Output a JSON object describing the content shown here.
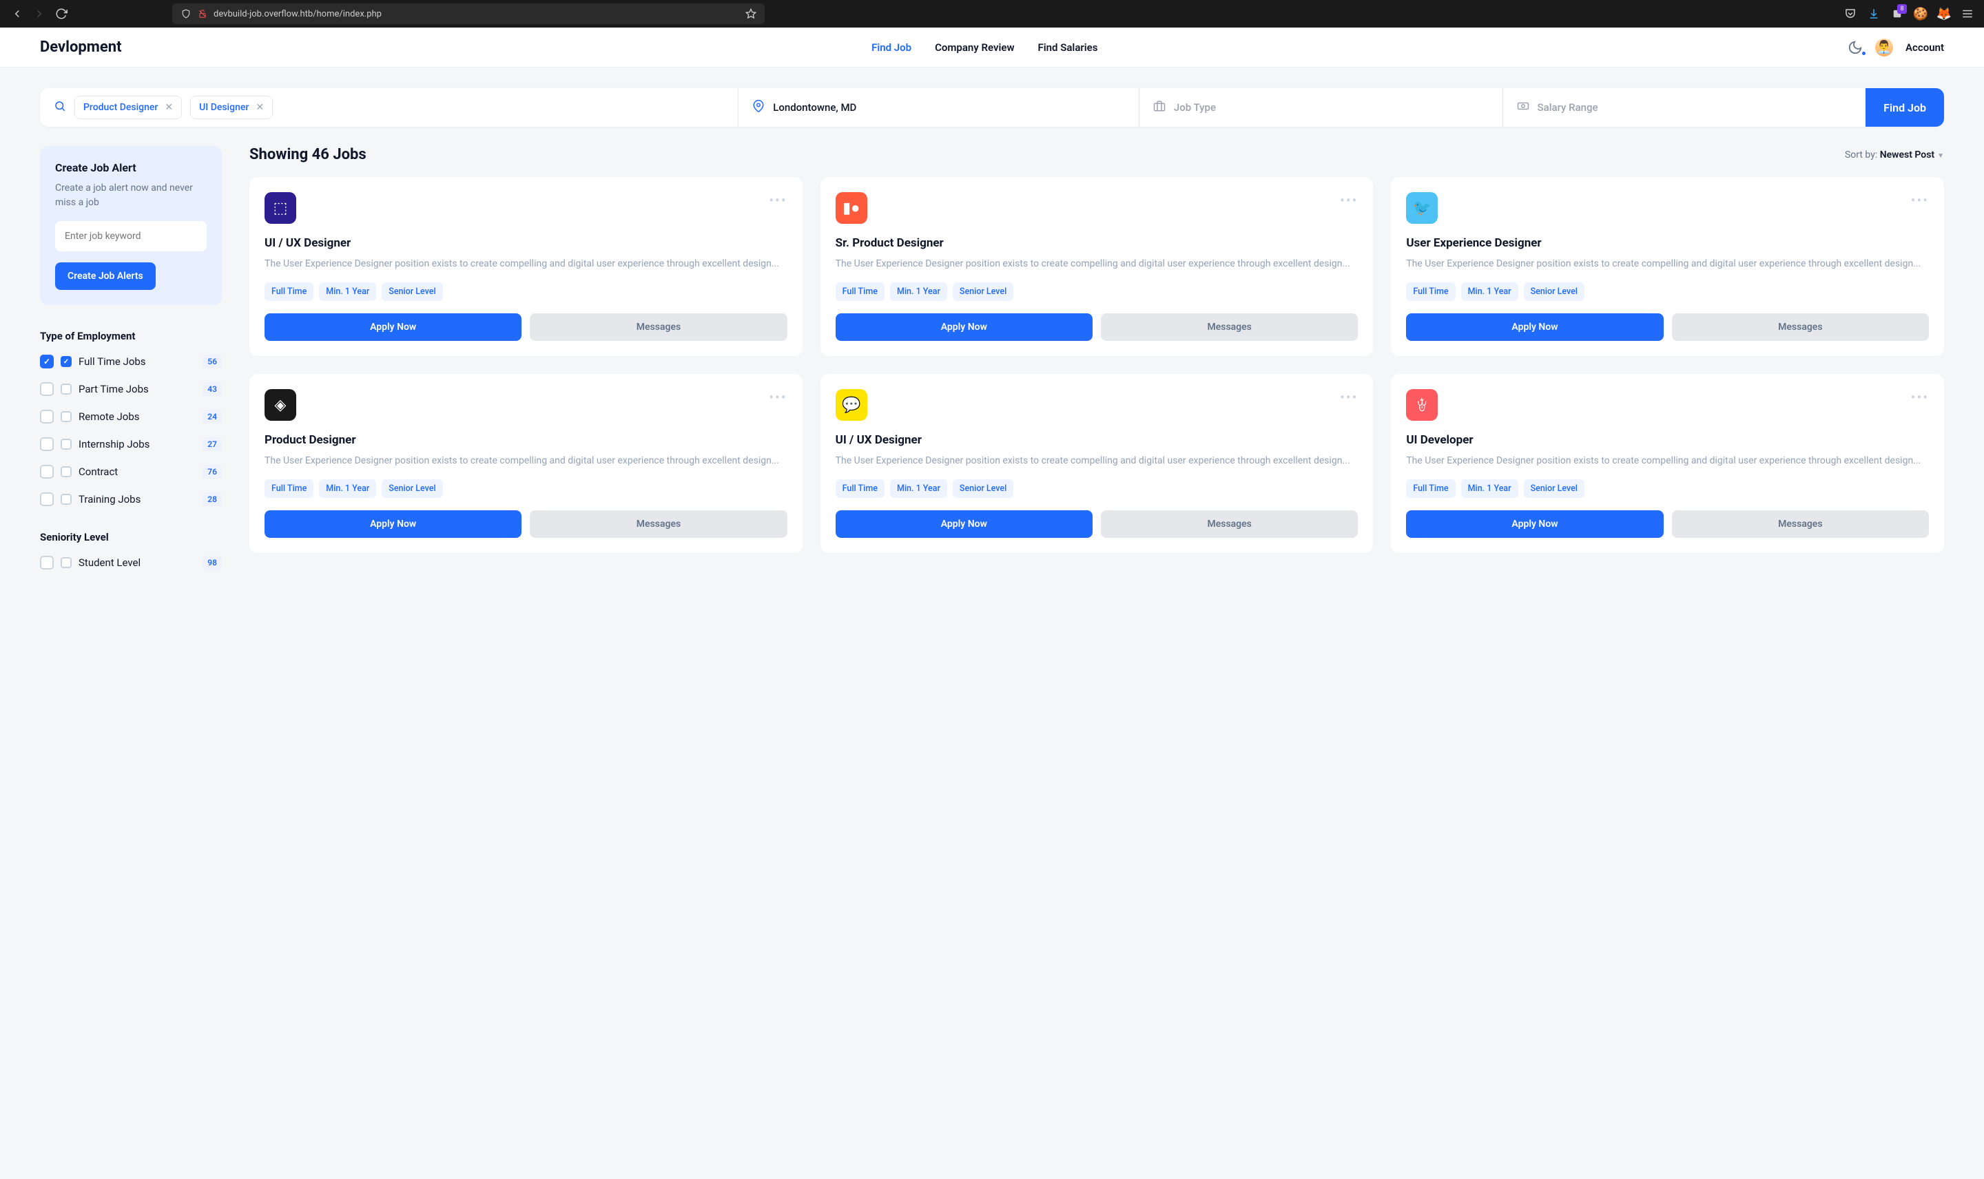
{
  "browser": {
    "url": "devbuild-job.overflow.htb/home/index.php",
    "badge": "8"
  },
  "header": {
    "logo": "Devlopment",
    "nav": [
      "Find Job",
      "Company Review",
      "Find Salaries"
    ],
    "account": "Account"
  },
  "search": {
    "tags": [
      "Product Designer",
      "UI Designer"
    ],
    "location": "Londontowne, MD",
    "jobtype_placeholder": "Job Type",
    "salary_placeholder": "Salary Range",
    "button": "Find Job"
  },
  "alert": {
    "title": "Create Job Alert",
    "desc": "Create a job alert now and never miss a job",
    "placeholder": "Enter job keyword",
    "button": "Create Job Alerts"
  },
  "filters": {
    "employment": {
      "heading": "Type of Employment",
      "items": [
        {
          "label": "Full Time Jobs",
          "count": "56",
          "outer_checked": true,
          "inner_checked": true
        },
        {
          "label": "Part Time Jobs",
          "count": "43",
          "outer_checked": false,
          "inner_checked": false
        },
        {
          "label": "Remote Jobs",
          "count": "24",
          "outer_checked": false,
          "inner_checked": false
        },
        {
          "label": "Internship Jobs",
          "count": "27",
          "outer_checked": false,
          "inner_checked": false
        },
        {
          "label": "Contract",
          "count": "76",
          "outer_checked": false,
          "inner_checked": false
        },
        {
          "label": "Training Jobs",
          "count": "28",
          "outer_checked": false,
          "inner_checked": false
        }
      ]
    },
    "seniority": {
      "heading": "Seniority Level",
      "items": [
        {
          "label": "Student Level",
          "count": "98",
          "outer_checked": false,
          "inner_checked": false
        }
      ]
    }
  },
  "results": {
    "heading": "Showing 46 Jobs",
    "sort_label": "Sort by: ",
    "sort_value": "Newest Post"
  },
  "jobs": [
    {
      "icon_class": "ci-dropbox",
      "icon_glyph": "⬚",
      "title": "UI / UX Designer",
      "desc": "The User Experience Designer position exists to create compelling and digital user experience through excellent design...",
      "tags": [
        "Full Time",
        "Min. 1 Year",
        "Senior Level"
      ],
      "apply": "Apply Now",
      "msg": "Messages"
    },
    {
      "icon_class": "ci-patreon",
      "icon_glyph": "▮●",
      "title": "Sr. Product Designer",
      "desc": "The User Experience Designer position exists to create compelling and digital user experience through excellent design...",
      "tags": [
        "Full Time",
        "Min. 1 Year",
        "Senior Level"
      ],
      "apply": "Apply Now",
      "msg": "Messages"
    },
    {
      "icon_class": "ci-twitter",
      "icon_glyph": "🐦",
      "title": "User Experience Designer",
      "desc": "The User Experience Designer position exists to create compelling and digital user experience through excellent design...",
      "tags": [
        "Full Time",
        "Min. 1 Year",
        "Senior Level"
      ],
      "apply": "Apply Now",
      "msg": "Messages"
    },
    {
      "icon_class": "ci-codepen",
      "icon_glyph": "◈",
      "title": "Product Designer",
      "desc": "The User Experience Designer position exists to create compelling and digital user experience through excellent design...",
      "tags": [
        "Full Time",
        "Min. 1 Year",
        "Senior Level"
      ],
      "apply": "Apply Now",
      "msg": "Messages"
    },
    {
      "icon_class": "ci-kakao",
      "icon_glyph": "💬",
      "title": "UI / UX Designer",
      "desc": "The User Experience Designer position exists to create compelling and digital user experience through excellent design...",
      "tags": [
        "Full Time",
        "Min. 1 Year",
        "Senior Level"
      ],
      "apply": "Apply Now",
      "msg": "Messages"
    },
    {
      "icon_class": "ci-airbnb",
      "icon_glyph": "ꄃ",
      "title": "UI Developer",
      "desc": "The User Experience Designer position exists to create compelling and digital user experience through excellent design...",
      "tags": [
        "Full Time",
        "Min. 1 Year",
        "Senior Level"
      ],
      "apply": "Apply Now",
      "msg": "Messages"
    }
  ]
}
